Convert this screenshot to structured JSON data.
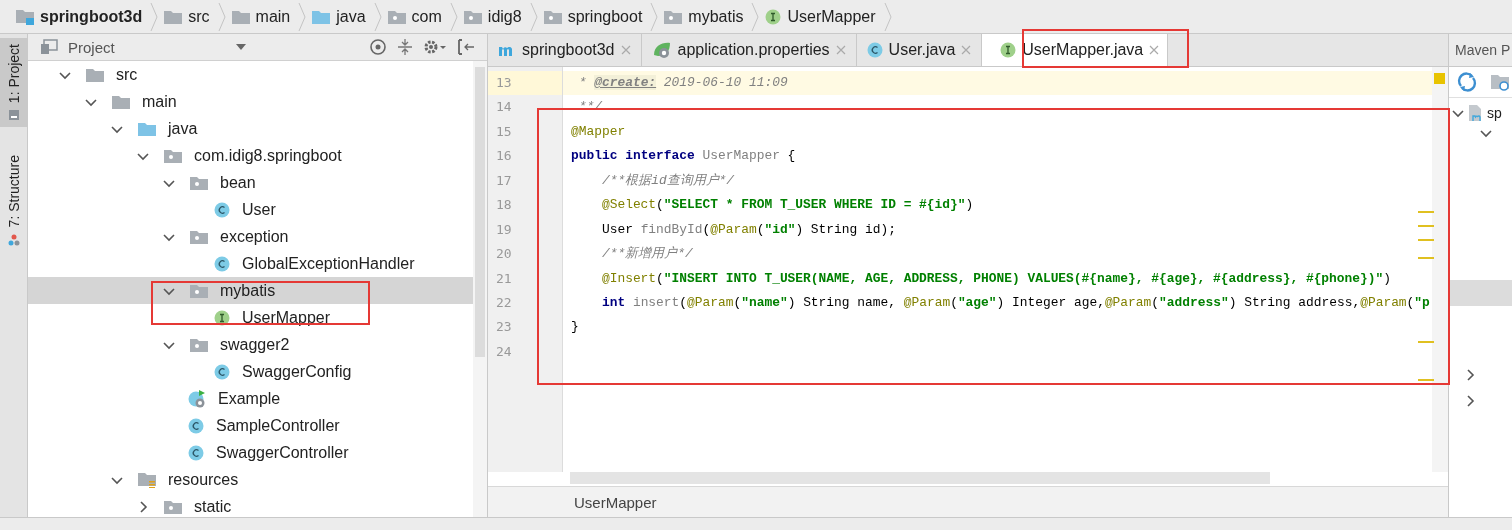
{
  "breadcrumb": [
    {
      "label": "springboot3d",
      "kind": "module"
    },
    {
      "label": "src",
      "kind": "folder"
    },
    {
      "label": "main",
      "kind": "folder"
    },
    {
      "label": "java",
      "kind": "source"
    },
    {
      "label": "com",
      "kind": "package"
    },
    {
      "label": "idig8",
      "kind": "package"
    },
    {
      "label": "springboot",
      "kind": "package"
    },
    {
      "label": "mybatis",
      "kind": "package"
    },
    {
      "label": "UserMapper",
      "kind": "interface"
    }
  ],
  "tool_strip": [
    {
      "label": "1: Project",
      "selected": true
    },
    {
      "label": "7: Structure",
      "selected": false
    }
  ],
  "project_panel": {
    "title": "Project",
    "tree": [
      {
        "label": "src",
        "kind": "folder",
        "expanded": true,
        "selected": false,
        "children": [
          {
            "label": "main",
            "kind": "folder",
            "expanded": true,
            "selected": false,
            "children": [
              {
                "label": "java",
                "kind": "source",
                "expanded": true,
                "selected": false,
                "children": [
                  {
                    "label": "com.idig8.springboot",
                    "kind": "package",
                    "expanded": true,
                    "selected": false,
                    "children": [
                      {
                        "label": "bean",
                        "kind": "package",
                        "expanded": true,
                        "selected": false,
                        "children": [
                          {
                            "label": "User",
                            "kind": "class",
                            "selected": false
                          }
                        ]
                      },
                      {
                        "label": "exception",
                        "kind": "package",
                        "expanded": true,
                        "selected": false,
                        "children": [
                          {
                            "label": "GlobalExceptionHandler",
                            "kind": "class",
                            "selected": false
                          }
                        ]
                      },
                      {
                        "label": "mybatis",
                        "kind": "package",
                        "expanded": true,
                        "selected": true,
                        "children": [
                          {
                            "label": "UserMapper",
                            "kind": "interface",
                            "selected": false
                          }
                        ]
                      },
                      {
                        "label": "swagger2",
                        "kind": "package",
                        "expanded": true,
                        "selected": false,
                        "children": [
                          {
                            "label": "SwaggerConfig",
                            "kind": "class",
                            "selected": false
                          }
                        ]
                      },
                      {
                        "label": "Example",
                        "kind": "spring",
                        "selected": false
                      },
                      {
                        "label": "SampleController",
                        "kind": "class",
                        "selected": false
                      },
                      {
                        "label": "SwaggerController",
                        "kind": "class",
                        "selected": false
                      }
                    ]
                  }
                ]
              },
              {
                "label": "resources",
                "kind": "resources",
                "expanded": true,
                "selected": false,
                "children": [
                  {
                    "label": "static",
                    "kind": "package",
                    "expanded": false,
                    "selected": false
                  }
                ]
              }
            ]
          }
        ]
      }
    ]
  },
  "editor": {
    "tabs": [
      {
        "label": "springboot3d",
        "kind": "maven",
        "selected": false
      },
      {
        "label": "application.properties",
        "kind": "spring",
        "selected": false
      },
      {
        "label": "User.java",
        "kind": "class",
        "selected": false
      },
      {
        "label": "UserMapper.java",
        "kind": "interface",
        "selected": true
      }
    ],
    "lines": [
      {
        "number": "13",
        "highlighted": true,
        "tokens": [
          {
            "kind": "comment",
            "text": " * "
          },
          {
            "kind": "doctag",
            "text": "@create:"
          },
          {
            "kind": "comment",
            "text": " 2019-06-10 11:09"
          }
        ]
      },
      {
        "number": "14",
        "highlighted": false,
        "tokens": [
          {
            "kind": "comment",
            "text": " **/"
          }
        ]
      },
      {
        "number": "15",
        "highlighted": false,
        "tokens": [
          {
            "kind": "annotation",
            "text": "@Mapper"
          }
        ]
      },
      {
        "number": "16",
        "highlighted": false,
        "tokens": [
          {
            "kind": "keyword",
            "text": "public"
          },
          {
            "kind": "keyword",
            "text": " interface"
          },
          {
            "kind": "unused",
            "text": " UserMapper"
          },
          {
            "kind": "plain",
            "text": " {"
          }
        ]
      },
      {
        "number": "17",
        "highlighted": false,
        "tokens": [
          {
            "kind": "comment",
            "text": "    /**根据id查询用户*/"
          }
        ]
      },
      {
        "number": "18",
        "highlighted": false,
        "tokens": [
          {
            "kind": "annotation",
            "text": "    @Select"
          },
          {
            "kind": "plain",
            "text": "("
          },
          {
            "kind": "string",
            "text": "\"SELECT * FROM T_USER WHERE ID = #{id}\""
          },
          {
            "kind": "plain",
            "text": ")"
          }
        ]
      },
      {
        "number": "19",
        "highlighted": false,
        "tokens": [
          {
            "kind": "plain",
            "text": "    User "
          },
          {
            "kind": "unused",
            "text": "findById"
          },
          {
            "kind": "plain",
            "text": "("
          },
          {
            "kind": "annotation",
            "text": "@Param"
          },
          {
            "kind": "plain",
            "text": "("
          },
          {
            "kind": "string",
            "text": "\"id\""
          },
          {
            "kind": "plain",
            "text": ") String id);"
          }
        ]
      },
      {
        "number": "20",
        "highlighted": false,
        "tokens": [
          {
            "kind": "comment",
            "text": "    /**新增用户*/"
          }
        ]
      },
      {
        "number": "21",
        "highlighted": false,
        "tokens": [
          {
            "kind": "annotation",
            "text": "    @Insert"
          },
          {
            "kind": "plain",
            "text": "("
          },
          {
            "kind": "string",
            "text": "\"INSERT INTO T_USER(NAME, AGE, ADDRESS, PHONE) VALUES(#{name}, #{age}, #{address}, #{phone})\""
          },
          {
            "kind": "plain",
            "text": ")"
          }
        ]
      },
      {
        "number": "22",
        "highlighted": false,
        "tokens": [
          {
            "kind": "keyword",
            "text": "    int"
          },
          {
            "kind": "unused",
            "text": " insert"
          },
          {
            "kind": "plain",
            "text": "("
          },
          {
            "kind": "annotation",
            "text": "@Param"
          },
          {
            "kind": "plain",
            "text": "("
          },
          {
            "kind": "string",
            "text": "\"name\""
          },
          {
            "kind": "plain",
            "text": ") String name, "
          },
          {
            "kind": "annotation",
            "text": "@Param"
          },
          {
            "kind": "plain",
            "text": "("
          },
          {
            "kind": "string",
            "text": "\"age\""
          },
          {
            "kind": "plain",
            "text": ") Integer age,"
          },
          {
            "kind": "annotation",
            "text": "@Param"
          },
          {
            "kind": "plain",
            "text": "("
          },
          {
            "kind": "string",
            "text": "\"address\""
          },
          {
            "kind": "plain",
            "text": ") String address,"
          },
          {
            "kind": "annotation",
            "text": "@Param"
          },
          {
            "kind": "plain",
            "text": "("
          },
          {
            "kind": "string",
            "text": "\"p"
          }
        ]
      },
      {
        "number": "23",
        "highlighted": false,
        "tokens": [
          {
            "kind": "plain",
            "text": "}"
          }
        ]
      },
      {
        "number": "24",
        "highlighted": false
      }
    ],
    "footer": "UserMapper"
  },
  "maven_panel": {
    "title": "Maven P",
    "tree": [
      {
        "label": "sp",
        "expanded": true
      }
    ]
  }
}
